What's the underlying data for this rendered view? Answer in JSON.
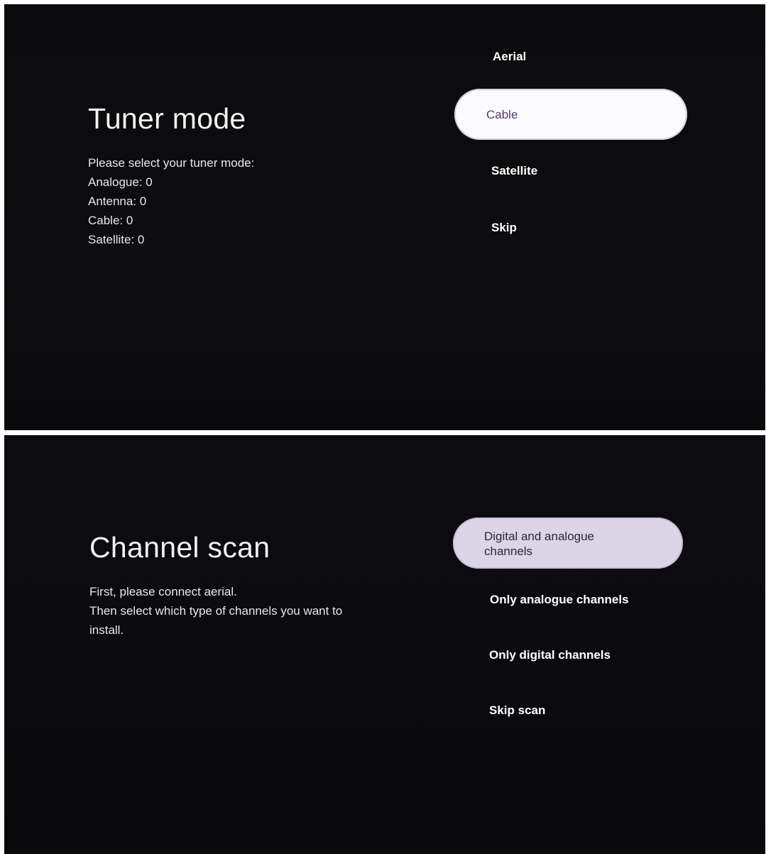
{
  "tuner_screen": {
    "title": "Tuner mode",
    "description": [
      "Please select your tuner mode:",
      "Analogue: 0",
      "Antenna: 0",
      "Cable: 0",
      "Satellite: 0"
    ],
    "options": [
      {
        "label": "Aerial",
        "selected": false
      },
      {
        "label": "Cable",
        "selected": true
      },
      {
        "label": "Satellite",
        "selected": false
      },
      {
        "label": "Skip",
        "selected": false
      }
    ]
  },
  "channel_scan_screen": {
    "title": "Channel scan",
    "description": [
      "First, please connect aerial.",
      "Then select which type of channels you want to",
      "install."
    ],
    "options": [
      {
        "label": "Digital and analogue channels",
        "line1": "Digital and analogue",
        "line2": "channels",
        "selected": true
      },
      {
        "label": "Only analogue channels",
        "selected": false
      },
      {
        "label": "Only digital channels",
        "selected": false
      },
      {
        "label": "Skip scan",
        "selected": false
      }
    ]
  },
  "colors": {
    "screen_background": "#0a0a0c",
    "selected_pill_top": "#fbfafc",
    "selected_text_top": "#5a3a68",
    "selected_pill_bottom": "#dcd5e8"
  }
}
